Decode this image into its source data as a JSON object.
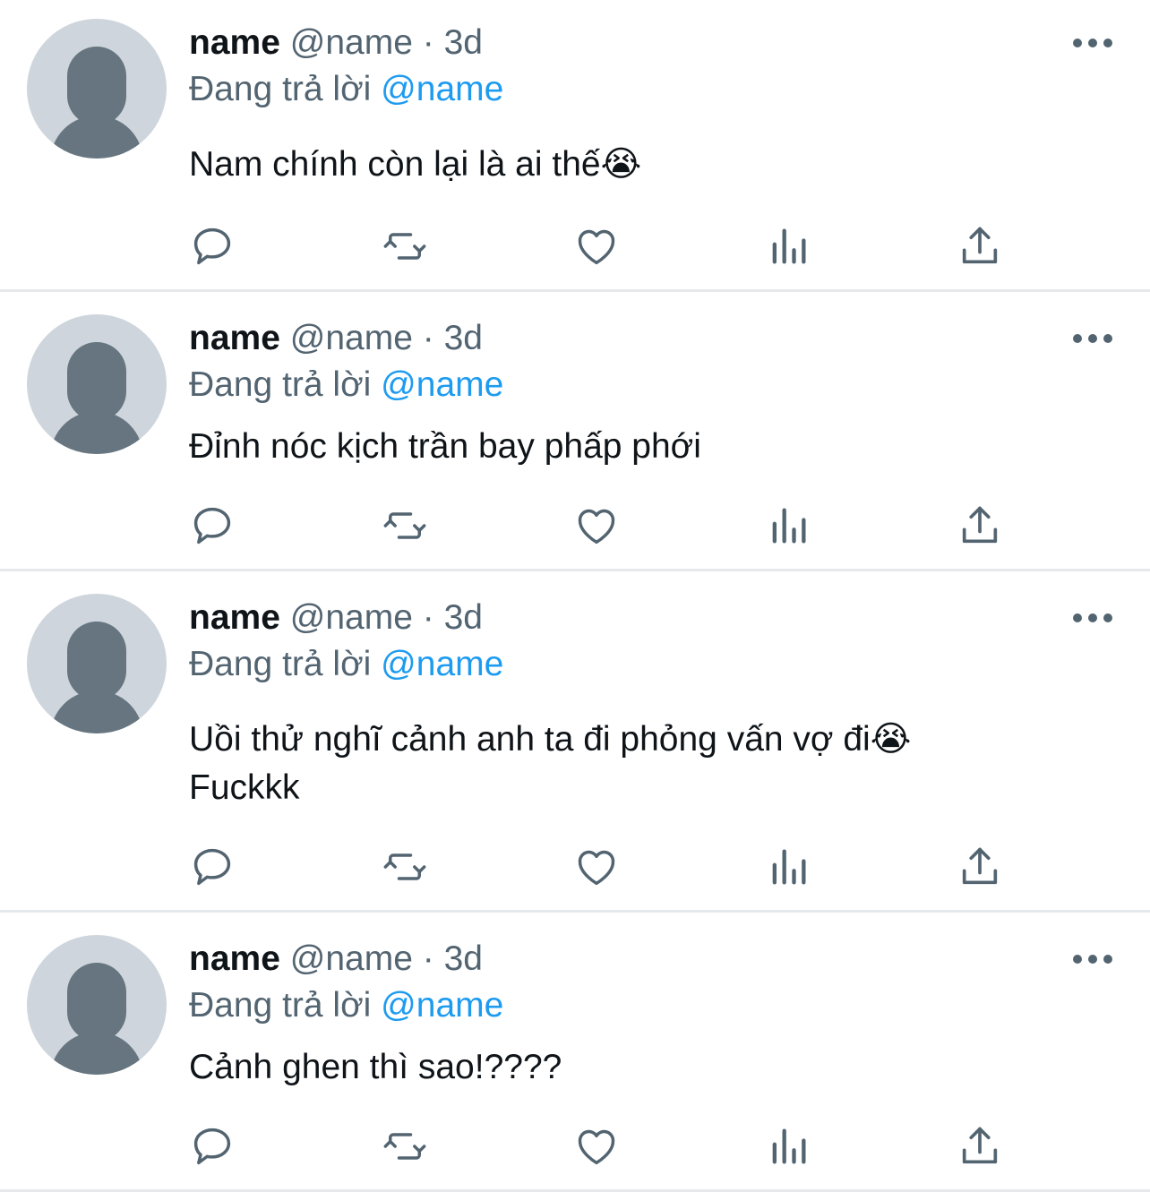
{
  "tweets": [
    {
      "name": "name",
      "handle": "@name",
      "sep": "·",
      "time": "3d",
      "reply_prefix": "Đang trả lời",
      "reply_to": "@name",
      "text": "Nam chính còn lại là ai thế😭"
    },
    {
      "name": "name",
      "handle": "@name",
      "sep": "·",
      "time": "3d",
      "reply_prefix": "Đang trả lời",
      "reply_to": "@name",
      "text": "Đỉnh nóc kịch trần bay phấp phới"
    },
    {
      "name": "name",
      "handle": "@name",
      "sep": "·",
      "time": "3d",
      "reply_prefix": "Đang trả lời",
      "reply_to": "@name",
      "text": "Uồi thử nghĩ cảnh anh ta đi phỏng vấn vợ đi😭\nFuckkk"
    },
    {
      "name": "name",
      "handle": "@name",
      "sep": "·",
      "time": "3d",
      "reply_prefix": "Đang trả lời",
      "reply_to": "@name",
      "text": "Cảnh ghen thì sao!????"
    }
  ],
  "icons": {
    "avatar": "default-avatar-icon",
    "more": "more-options-icon",
    "reply": "reply-icon",
    "retweet": "retweet-icon",
    "like": "like-heart-icon",
    "views": "views-chart-icon",
    "share": "share-icon"
  },
  "colors": {
    "text": "#0f1419",
    "secondary": "#536471",
    "mention": "#1d9bf0",
    "avatar_bg": "#ced5dc",
    "avatar_fg": "#66757f",
    "divider": "#e6e9ec"
  }
}
